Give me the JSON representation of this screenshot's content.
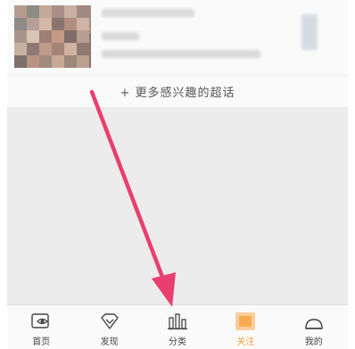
{
  "feed": {
    "more_topics_label": "+ 更多感兴趣的超话"
  },
  "tabbar": {
    "active_color": "#f5a040",
    "tabs": [
      {
        "label": "首页",
        "icon": "home-eye-icon"
      },
      {
        "label": "发现",
        "icon": "discover-diamond-icon"
      },
      {
        "label": "分类",
        "icon": "category-bars-icon"
      },
      {
        "label": "关注",
        "icon": "follow-icon"
      },
      {
        "label": "我的",
        "icon": "profile-icon"
      }
    ]
  },
  "annotation": {
    "arrow_color": "#e83f6f"
  }
}
